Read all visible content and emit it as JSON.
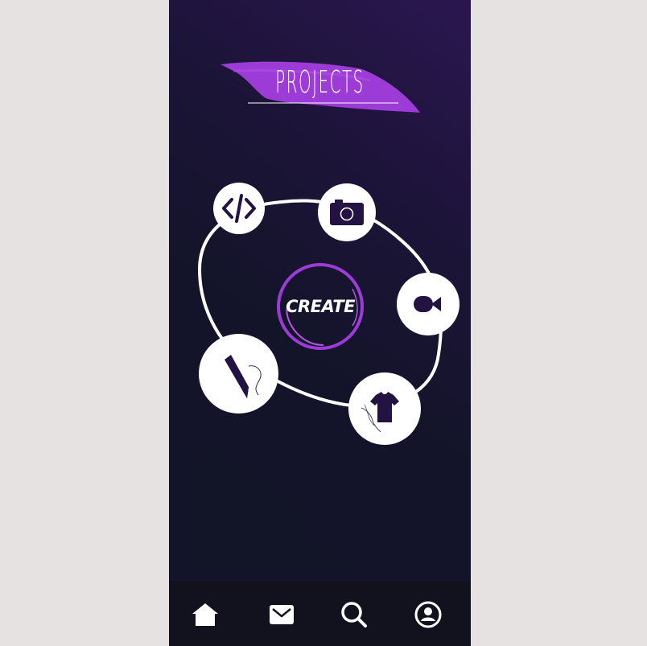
{
  "header": {
    "title": "PROJECTS"
  },
  "center": {
    "create_label": "CREATE"
  },
  "categories": [
    {
      "name": "code",
      "icon": "code-icon"
    },
    {
      "name": "photo",
      "icon": "camera-icon"
    },
    {
      "name": "video",
      "icon": "video-camera-icon"
    },
    {
      "name": "apparel",
      "icon": "t-shirt-icon"
    },
    {
      "name": "design",
      "icon": "pen-icon"
    }
  ],
  "nav": [
    {
      "name": "home",
      "icon": "home-icon"
    },
    {
      "name": "messages",
      "icon": "mail-icon"
    },
    {
      "name": "search",
      "icon": "search-icon"
    },
    {
      "name": "profile",
      "icon": "user-icon"
    }
  ],
  "colors": {
    "accent": "#9c3bd6",
    "icon_dark": "#231342",
    "background": "#131429"
  }
}
